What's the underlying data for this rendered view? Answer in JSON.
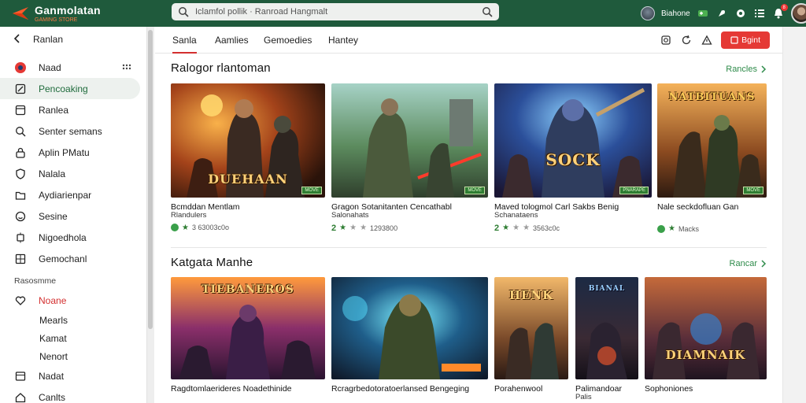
{
  "app": {
    "name": "Ganmolatan",
    "tagline": "GAMING STORE",
    "accent": "#1f5a3c",
    "highlight": "#e53935"
  },
  "search": {
    "value": "Iclamfol pollik · Ranroad Hangmalt",
    "icon_left": "search-icon",
    "icon_right": "search-icon"
  },
  "topbar": {
    "username": "Biahone",
    "notification_count": "8"
  },
  "sidebar": {
    "back_label": "Ranlan",
    "items": [
      {
        "label": "Naad",
        "icon": "game-controller-icon"
      },
      {
        "label": "Pencoaking",
        "icon": "edit-icon",
        "active": true
      },
      {
        "label": "Ranlea",
        "icon": "square-icon"
      },
      {
        "label": "Senter semans",
        "icon": "search-icon"
      },
      {
        "label": "Aplin PMatu",
        "icon": "lock-icon"
      },
      {
        "label": "Nalala",
        "icon": "shield-icon"
      },
      {
        "label": "Aydiarienpar",
        "icon": "folder-icon"
      },
      {
        "label": "Sesine",
        "icon": "smile-icon"
      },
      {
        "label": "Nigoedhola",
        "icon": "chip-icon"
      },
      {
        "label": "Gemochanl",
        "icon": "grid-icon"
      }
    ],
    "section_label": "Rasosmme",
    "section_items": [
      {
        "label": "Noane",
        "icon": "heart-icon",
        "red": true
      },
      {
        "label": "Mearls"
      },
      {
        "label": "Kamat"
      },
      {
        "label": "Nenort"
      }
    ],
    "bottom_items": [
      {
        "label": "Nadat",
        "icon": "box-icon"
      },
      {
        "label": "Canlts",
        "icon": "home-icon"
      }
    ]
  },
  "tabs": [
    {
      "label": "Sanla",
      "active": true
    },
    {
      "label": "Aamlies"
    },
    {
      "label": "Gemoedies"
    },
    {
      "label": "Hantey"
    }
  ],
  "toolbar": {
    "button_label": "Bgint"
  },
  "sections": [
    {
      "title": "Ralogor rlantoman",
      "more_label": "Rancles",
      "cards": [
        {
          "title": "Bcmddan Mentlam",
          "subtitle": "Rlandulers",
          "meta": "3 63003c0o",
          "thumb_title": "DUEHAAN",
          "rank": "",
          "stars": 0,
          "dot": true,
          "badge": "MOVE"
        },
        {
          "title": "Gragon Sotanitanten Cencathabl",
          "subtitle": "Salonahats",
          "meta": "2 ★★★ 1293800",
          "thumb_title": "",
          "rank": "2",
          "stars": 2,
          "dot": false,
          "badge": "MOVE"
        },
        {
          "title": "Maved tologmol Carl Sakbs Benig",
          "subtitle": "Schanataens",
          "meta": "3 ★★★ 3563c0c",
          "thumb_title": "SOCK",
          "rank": "2",
          "stars": 2,
          "dot": false,
          "badge": "PNARAPE"
        },
        {
          "title": "Nale seckdofluan Gan",
          "subtitle": "",
          "meta": "Macks",
          "thumb_title": "NATBITUANS",
          "rank": "",
          "stars": 1,
          "dot": true,
          "badge": "MOVE"
        }
      ]
    },
    {
      "title": "Katgata Manhe",
      "more_label": "Rancar",
      "cards": [
        {
          "title": "Ragdtomlaerideres Noadethinide",
          "thumb_title": "TIEBANEROS"
        },
        {
          "title": "Rcragrbedotoratoerlansed Bengeging",
          "thumb_title": ""
        },
        {
          "title": "Porahenwool",
          "thumb_title": "HENK"
        },
        {
          "title": "Palimandoar",
          "subtitle": "Palis",
          "thumb_title": "BIANAL"
        },
        {
          "title": "Sophoniones",
          "thumb_title": "DIAMNAIK"
        }
      ]
    }
  ]
}
